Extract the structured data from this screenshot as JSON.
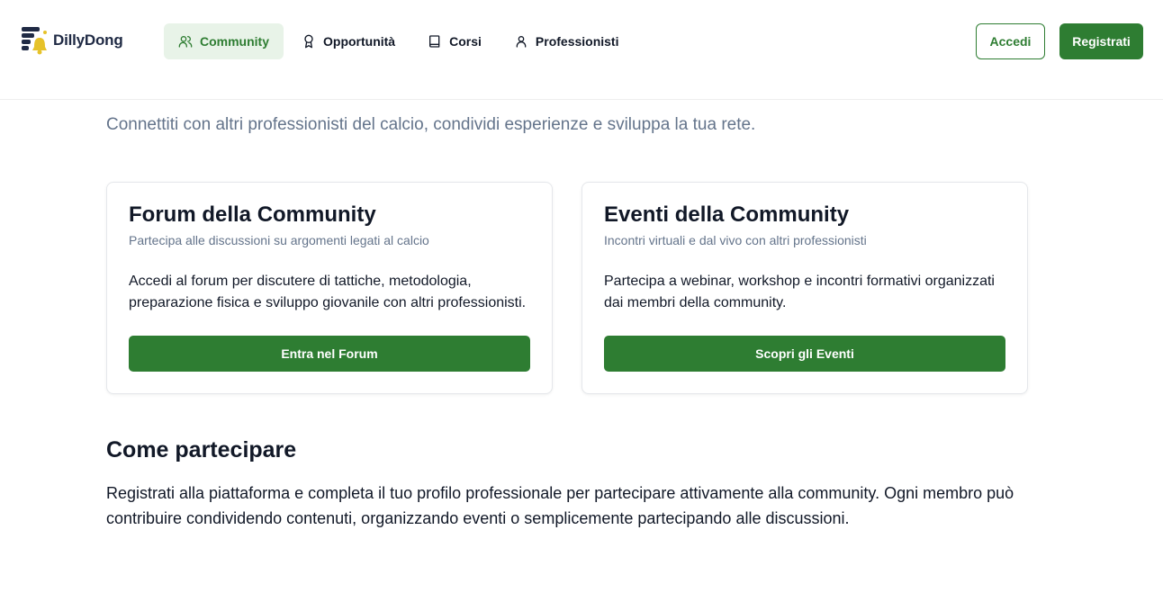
{
  "brand": {
    "name": "DillyDong"
  },
  "nav": {
    "items": [
      {
        "label": "Community",
        "icon": "users-icon",
        "active": true
      },
      {
        "label": "Opportunità",
        "icon": "award-icon",
        "active": false
      },
      {
        "label": "Corsi",
        "icon": "book-icon",
        "active": false
      },
      {
        "label": "Professionisti",
        "icon": "user-icon",
        "active": false
      }
    ]
  },
  "auth": {
    "login_label": "Accedi",
    "register_label": "Registrati"
  },
  "page": {
    "subtitle": "Connettiti con altri professionisti del calcio, condividi esperienze e sviluppa la tua rete."
  },
  "cards": [
    {
      "title": "Forum della Community",
      "description": "Partecipa alle discussioni su argomenti legati al calcio",
      "body": "Accedi al forum per discutere di tattiche, metodologia, preparazione fisica e sviluppo giovanile con altri professionisti.",
      "button": "Entra nel Forum"
    },
    {
      "title": "Eventi della Community",
      "description": "Incontri virtuali e dal vivo con altri professionisti",
      "body": "Partecipa a webinar, workshop e incontri formativi organizzati dai membri della community.",
      "button": "Scopri gli Eventi"
    }
  ],
  "participate": {
    "title": "Come partecipare",
    "text": "Registrati alla piattaforma e completa il tuo profilo professionale per partecipare attivamente alla community. Ogni membro può contribuire condividendo contenuti, organizzando eventi o semplicemente partecipando alle discussioni."
  },
  "colors": {
    "accent": "#2e7d32",
    "accent_light": "#e8f3e8",
    "muted": "#64748b",
    "logo_yellow": "#e6c229"
  }
}
